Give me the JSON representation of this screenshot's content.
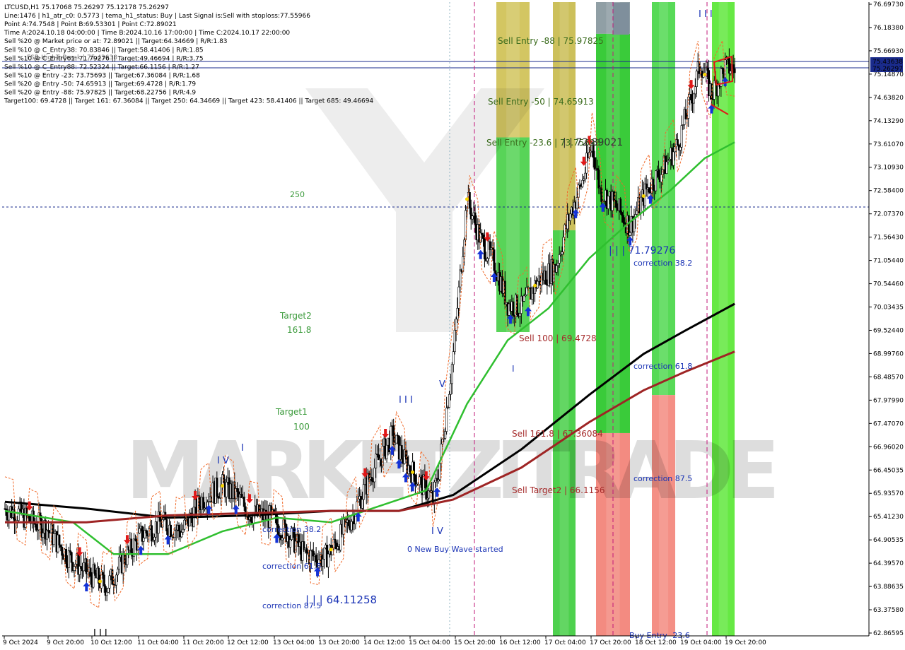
{
  "hud": [
    "LTCUSD,H1  75.17068 75.26297 75.12178 75.26297",
    "Line:1476  | h1_atr_c0: 0.5773  | tema_h1_status: Buy  | Last Signal is:Sell with stoploss:77.55966",
    "Point A:74.7548  | Point B:69.53301  | Point C:72.89021",
    "Time A:2024.10.18 04:00:00  | Time B:2024.10.16 17:00:00  | Time C:2024.10.17 22:00:00",
    "Sell %20 @ Market price or at: 72.89021  || Target:64.34669  | R/R:1.83",
    "Sell %10 @ C_Entry38: 70.83846  || Target:58.41406  | R/R:1.85",
    "Sell %10 @ C_Entry61: 71.79276  || Target:49.46694  | R/R:3.75",
    "Sell %10 @ C_Entry88: 72.52324  || Target:66.1156  | R/R:1.27",
    "Sell %10 @ Entry -23: 73.75693  || Target:67.36084  | R/R:1.68",
    "Sell %20 @ Entry -50: 74.65913  || Target:69.4728  | R/R:1.79",
    "Sell %20 @ Entry -88: 75.97825  || Target:68.22756  | R/R:4.9",
    "Target100: 69.4728  || Target 161: 67.36084  || Target 250: 64.34669  || Target 423: 58.41406  || Target 685: 49.46694"
  ],
  "hud_overlay": "FSB-HighToBreak | 75.43638",
  "watermark": "MARKETZITRADE",
  "chart_data": {
    "type": "candlestick",
    "symbol": "LTCUSD",
    "timeframe": "H1",
    "ylim": [
      62.86595,
      76.6973
    ],
    "y_ticks": [
      "76.69730",
      "76.18380",
      "75.66930",
      "75.14870",
      "74.63820",
      "74.13290",
      "73.61070",
      "73.10930",
      "72.58400",
      "72.07370",
      "71.56430",
      "71.05440",
      "70.54460",
      "70.03435",
      "69.52440",
      "68.99760",
      "68.48570",
      "67.97990",
      "67.47070",
      "66.96020",
      "66.45035",
      "65.93570",
      "65.41230",
      "64.90535",
      "64.39570",
      "63.88635",
      "63.37580",
      "62.86595"
    ],
    "x_ticks": [
      "9 Oct 2024",
      "9 Oct 20:00",
      "10 Oct 12:00",
      "11 Oct 04:00",
      "11 Oct 20:00",
      "12 Oct 12:00",
      "13 Oct 04:00",
      "13 Oct 20:00",
      "14 Oct 12:00",
      "15 Oct 04:00",
      "15 Oct 20:00",
      "16 Oct 12:00",
      "17 Oct 04:00",
      "17 Oct 20:00",
      "18 Oct 12:00",
      "19 Oct 04:00",
      "19 Oct 20:00"
    ],
    "price_tags": [
      {
        "value": "75.43638",
        "color": "#1a2b8c"
      },
      {
        "value": "75.26297",
        "color": "#1a2b8c"
      }
    ],
    "hlines": [
      75.43638,
      75.26297,
      72.07
    ],
    "closes_keypoints": [
      [
        0,
        65.6
      ],
      [
        10,
        65.5
      ],
      [
        20,
        65.3
      ],
      [
        30,
        65.2
      ],
      [
        45,
        64.6
      ],
      [
        60,
        64.2
      ],
      [
        75,
        63.9
      ],
      [
        90,
        64.6
      ],
      [
        100,
        65.0
      ],
      [
        115,
        65.3
      ],
      [
        130,
        65.1
      ],
      [
        145,
        65.8
      ],
      [
        160,
        66.1
      ],
      [
        170,
        65.9
      ],
      [
        180,
        65.5
      ],
      [
        195,
        65.4
      ],
      [
        210,
        65.0
      ],
      [
        220,
        64.6
      ],
      [
        235,
        64.5
      ],
      [
        245,
        64.9
      ],
      [
        255,
        65.4
      ],
      [
        270,
        66.4
      ],
      [
        285,
        67.2
      ],
      [
        295,
        66.6
      ],
      [
        305,
        66.2
      ],
      [
        315,
        65.8
      ],
      [
        320,
        66.6
      ],
      [
        330,
        69.0
      ],
      [
        340,
        72.4
      ],
      [
        350,
        71.5
      ],
      [
        360,
        71.0
      ],
      [
        370,
        70.1
      ],
      [
        380,
        70.0
      ],
      [
        392,
        70.6
      ],
      [
        405,
        70.9
      ],
      [
        415,
        72.0
      ],
      [
        425,
        72.8
      ],
      [
        432,
        73.6
      ],
      [
        438,
        72.6
      ],
      [
        448,
        72.3
      ],
      [
        460,
        71.8
      ],
      [
        472,
        72.6
      ],
      [
        485,
        73.1
      ],
      [
        495,
        73.6
      ],
      [
        505,
        74.6
      ],
      [
        512,
        75.4
      ],
      [
        520,
        74.7
      ],
      [
        530,
        75.3
      ],
      [
        537,
        75.26
      ]
    ],
    "series": [
      {
        "name": "",
        "color": "#2fbf2f",
        "points": [
          [
            0,
            65.55
          ],
          [
            50,
            65.3
          ],
          [
            80,
            64.6
          ],
          [
            120,
            64.6
          ],
          [
            160,
            65.1
          ],
          [
            200,
            65.4
          ],
          [
            240,
            65.3
          ],
          [
            280,
            65.7
          ],
          [
            310,
            66.0
          ],
          [
            340,
            67.9
          ],
          [
            370,
            69.3
          ],
          [
            400,
            70.0
          ],
          [
            430,
            71.1
          ],
          [
            460,
            71.9
          ],
          [
            490,
            72.6
          ],
          [
            515,
            73.3
          ],
          [
            537,
            73.65
          ]
        ]
      },
      {
        "name": "",
        "color": "#000000",
        "points": [
          [
            0,
            65.75
          ],
          [
            60,
            65.6
          ],
          [
            120,
            65.4
          ],
          [
            180,
            65.45
          ],
          [
            240,
            65.55
          ],
          [
            290,
            65.55
          ],
          [
            330,
            65.9
          ],
          [
            380,
            66.9
          ],
          [
            430,
            68.1
          ],
          [
            470,
            69.0
          ],
          [
            500,
            69.5
          ],
          [
            537,
            70.1
          ]
        ]
      },
      {
        "name": "",
        "color": "#9e2424",
        "points": [
          [
            0,
            65.3
          ],
          [
            60,
            65.3
          ],
          [
            120,
            65.45
          ],
          [
            180,
            65.5
          ],
          [
            240,
            65.55
          ],
          [
            290,
            65.55
          ],
          [
            330,
            65.8
          ],
          [
            380,
            66.5
          ],
          [
            430,
            67.5
          ],
          [
            470,
            68.2
          ],
          [
            500,
            68.6
          ],
          [
            537,
            69.05
          ]
        ]
      }
    ],
    "zones": [
      {
        "x": 702,
        "w": 47,
        "top": 3,
        "bottom": 470,
        "kind": "olive-green"
      },
      {
        "x": 782,
        "w": 32,
        "top": 3,
        "bottom": 900,
        "kind": "olive-green"
      },
      {
        "x": 843,
        "w": 48,
        "top": 3,
        "bottom": 900,
        "kind": "green-salmon"
      },
      {
        "x": 922,
        "w": 33,
        "top": 3,
        "bottom": 900,
        "kind": "green-salmon"
      },
      {
        "x": 1007,
        "w": 32,
        "top": 3,
        "bottom": 900,
        "kind": "lime"
      }
    ]
  },
  "annotations": {
    "sell_entry_88": "Sell Entry -88 | 75.97825",
    "sell_entry_50": "Sell Entry -50 | 74.65913",
    "sell_entry_23": "Sell Entry -23.6 | 73.75693",
    "c_value": "| | 72.89021",
    "level_250": "250",
    "target2": "Target2",
    "target2_val": "161.8",
    "target1": "Target1",
    "target1_val": "100",
    "point_b_val": "| | | 71.79276",
    "correction_38_right": "correction 38.2",
    "correction_61_right": "correction 61.8",
    "correction_87_right": "correction 87.5",
    "sell_100": "Sell 100 | 69.4728",
    "sell_161": "Sell 161.8 | 67.36084",
    "sell_target2": "Sell Target2 | 66.1156",
    "correction_38_left": "correction 38.2",
    "correction_61_left": "correction 61.8",
    "correction_87_left": "correction 87.5",
    "low_val": "| | | 64.11258",
    "new_buy_wave": "0 New Buy Wave started",
    "wave_iv_left": "I V",
    "wave_iv_mid": "I V",
    "wave_v": "V",
    "wave_iii": "I I I",
    "wave_i": "I",
    "wave_iii_top": "I I I",
    "wave_i_mid": "I",
    "wave_iii_bottom": "I I I",
    "buy_entry_partial": "Buy Entry -23.6"
  }
}
